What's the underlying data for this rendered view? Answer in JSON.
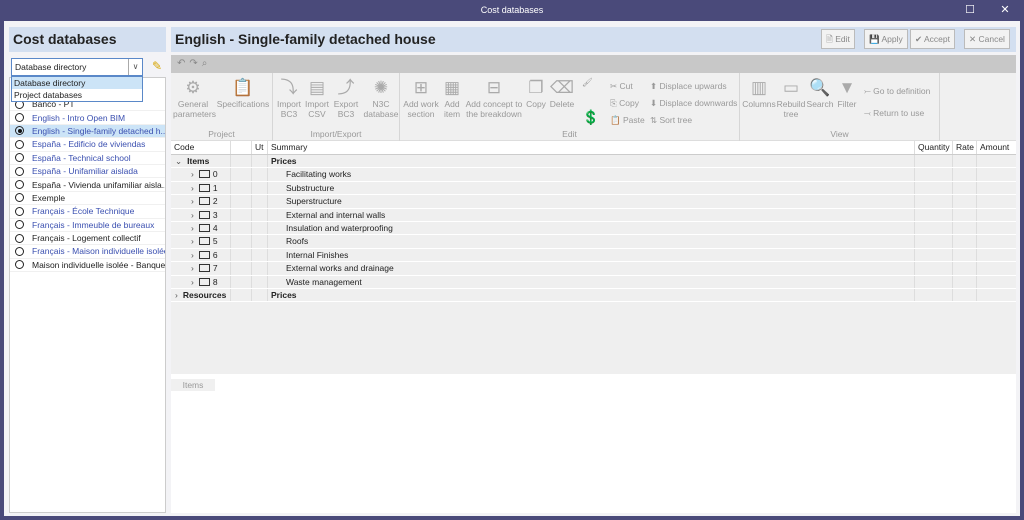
{
  "window": {
    "title": "Cost databases",
    "maximize_icon": "maximize-icon",
    "close_icon": "close-icon"
  },
  "left": {
    "title": "Cost databases",
    "combo_value": "Database directory",
    "combo_options": [
      "Database directory",
      "Project databases"
    ],
    "databases": [
      {
        "label": "Banco - PT",
        "blue": false,
        "selected": false
      },
      {
        "label": "English - Intro Open BIM",
        "blue": true,
        "selected": false
      },
      {
        "label": "English - Single-family detached h...",
        "blue": true,
        "selected": true
      },
      {
        "label": "España - Edificio de viviendas",
        "blue": true,
        "selected": false
      },
      {
        "label": "España - Technical school",
        "blue": true,
        "selected": false
      },
      {
        "label": "España - Unifamiliar aislada",
        "blue": true,
        "selected": false
      },
      {
        "label": "España - Vivienda unifamiliar aisla...",
        "blue": false,
        "selected": false
      },
      {
        "label": "Exemple",
        "blue": false,
        "selected": false
      },
      {
        "label": "Français - École Technique",
        "blue": true,
        "selected": false
      },
      {
        "label": "Français - Immeuble de bureaux",
        "blue": true,
        "selected": false
      },
      {
        "label": "Français - Logement collectif",
        "blue": false,
        "selected": false
      },
      {
        "label": "Français - Maison individuelle isolée",
        "blue": true,
        "selected": false
      },
      {
        "label": "Maison individuelle isolée - Banque",
        "blue": false,
        "selected": false
      }
    ]
  },
  "right": {
    "title": "English - Single-family detached house",
    "buttons": {
      "edit": "Edit",
      "apply": "Apply",
      "accept": "Accept",
      "cancel": "Cancel"
    },
    "ribbon": {
      "project": {
        "label": "Project",
        "general": "General parameters",
        "specs": "Specifications"
      },
      "io": {
        "label": "Import/Export",
        "import_bc3": "Import BC3",
        "import_csv": "Import CSV",
        "export_bc3": "Export BC3",
        "n3c": "N3C database"
      },
      "edit": {
        "label": "Edit",
        "add_ws": "Add work section",
        "add_item": "Add item",
        "add_concept": "Add concept to the breakdown",
        "copy": "Copy",
        "delete": "Delete",
        "cut": "Cut",
        "copy2": "Copy",
        "paste": "Paste",
        "up": "Displace upwards",
        "down": "Displace downwards",
        "sort": "Sort tree"
      },
      "view": {
        "label": "View",
        "columns": "Columns",
        "rebuild": "Rebuild tree",
        "search": "Search",
        "filter": "Filter",
        "goto": "Go to definition",
        "return": "Return to use"
      }
    },
    "table": {
      "headers": {
        "code": "Code",
        "ut": "Ut",
        "summary": "Summary",
        "quantity": "Quantity",
        "rate": "Rate",
        "amount": "Amount"
      },
      "items": {
        "code": "Items",
        "summary": "Prices"
      },
      "chapters": [
        {
          "code": "0",
          "summary": "Facilitating works"
        },
        {
          "code": "1",
          "summary": "Substructure"
        },
        {
          "code": "2",
          "summary": "Superstructure"
        },
        {
          "code": "3",
          "summary": "External and internal walls"
        },
        {
          "code": "4",
          "summary": "Insulation and waterproofing"
        },
        {
          "code": "5",
          "summary": "Roofs"
        },
        {
          "code": "6",
          "summary": "Internal Finishes"
        },
        {
          "code": "7",
          "summary": "External works and drainage"
        },
        {
          "code": "8",
          "summary": "Waste management"
        }
      ],
      "resources": {
        "code": "Resources",
        "summary": "Prices"
      }
    },
    "bottom_tab": "Items"
  }
}
